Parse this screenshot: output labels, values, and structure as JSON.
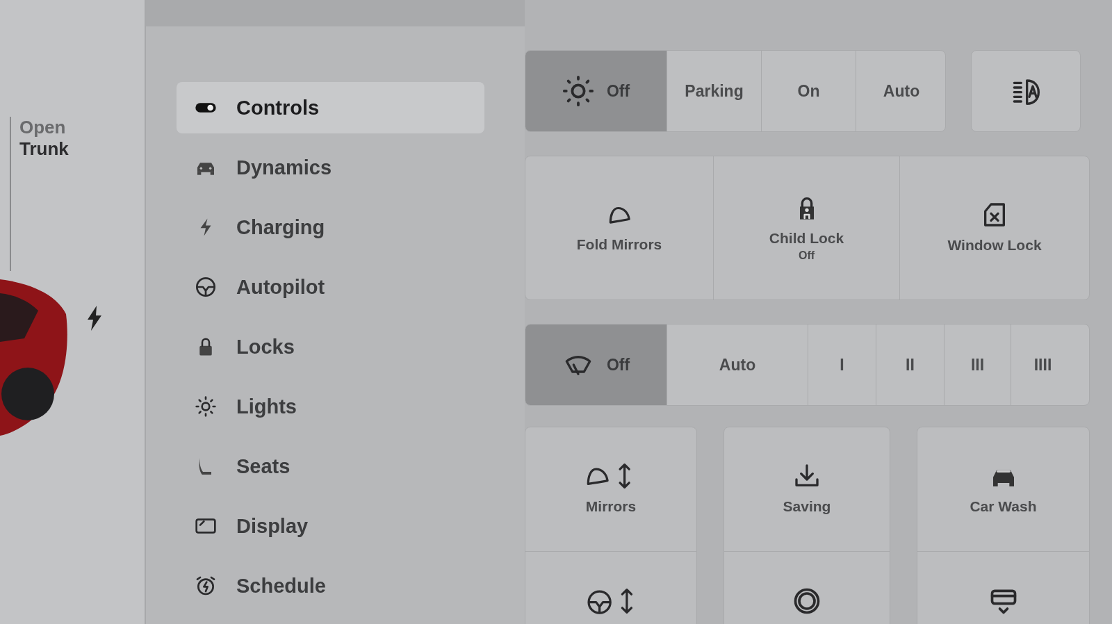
{
  "trunk": {
    "action": "Open",
    "target": "Trunk"
  },
  "nav": {
    "items": [
      {
        "label": "Controls",
        "selected": true
      },
      {
        "label": "Dynamics",
        "selected": false
      },
      {
        "label": "Charging",
        "selected": false
      },
      {
        "label": "Autopilot",
        "selected": false
      },
      {
        "label": "Locks",
        "selected": false
      },
      {
        "label": "Lights",
        "selected": false
      },
      {
        "label": "Seats",
        "selected": false
      },
      {
        "label": "Display",
        "selected": false
      },
      {
        "label": "Schedule",
        "selected": false
      }
    ]
  },
  "headlights": {
    "options": [
      {
        "label": "Off",
        "selected": true
      },
      {
        "label": "Parking",
        "selected": false
      },
      {
        "label": "On",
        "selected": false
      },
      {
        "label": "Auto",
        "selected": false
      }
    ]
  },
  "quick_controls": [
    {
      "label": "Fold Mirrors"
    },
    {
      "label": "Child Lock",
      "status": "Off"
    },
    {
      "label": "Window Lock"
    }
  ],
  "wipers": {
    "options": [
      {
        "label": "Off",
        "selected": true
      },
      {
        "label": "Auto",
        "selected": false
      },
      {
        "label": "I",
        "selected": false
      },
      {
        "label": "II",
        "selected": false
      },
      {
        "label": "III",
        "selected": false
      },
      {
        "label": "IIII",
        "selected": false
      }
    ]
  },
  "shortcuts": [
    {
      "label": "Mirrors"
    },
    {
      "label": "Saving"
    },
    {
      "label": "Car Wash"
    }
  ]
}
